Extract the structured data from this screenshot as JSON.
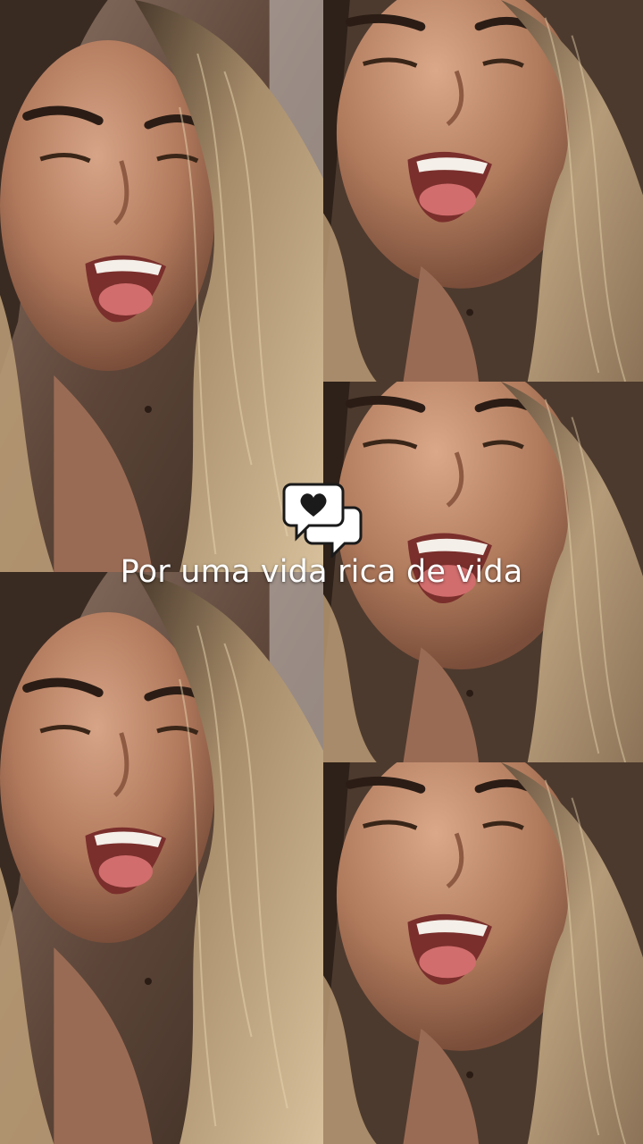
{
  "story": {
    "caption": "Por uma vida rica de vida",
    "sticker_icon": "heart-chat-bubbles-icon"
  },
  "photos": {
    "subject": "selfie-photo",
    "layout": "collage-5-tiles"
  },
  "colors": {
    "caption_text": "#ffffff",
    "sticker": "#ffffff",
    "sticker_heart": "#1a1a1a"
  }
}
